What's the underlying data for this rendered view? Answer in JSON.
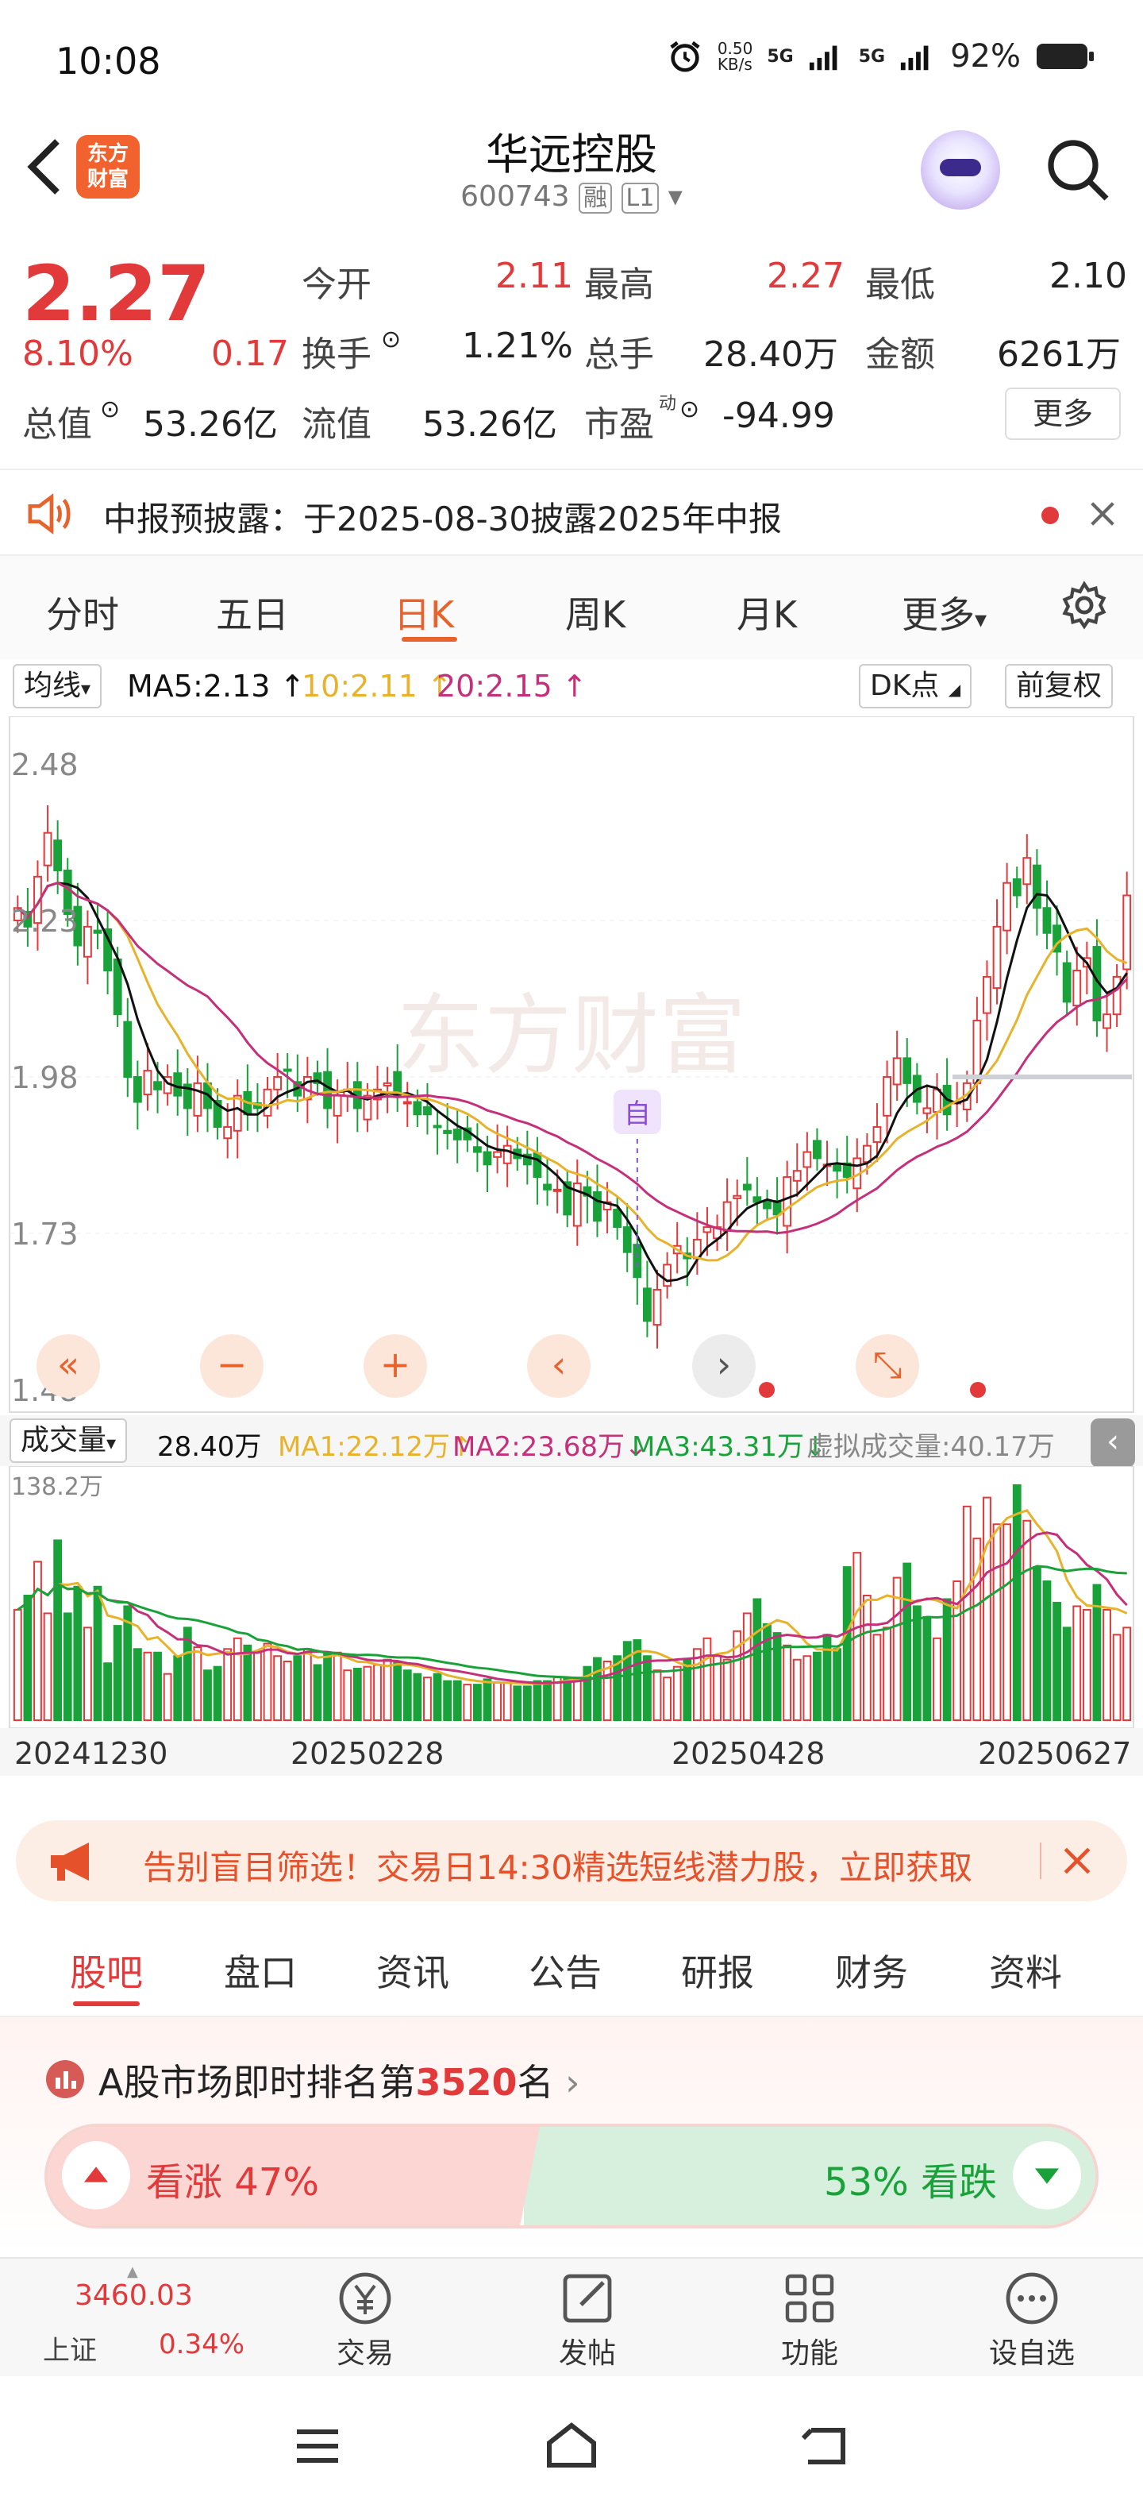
{
  "status_bar": {
    "time": "10:08",
    "net_speed": "0.50\nKB/s",
    "net1": "5G",
    "net2": "5G",
    "battery": "92%"
  },
  "header": {
    "brand": "东方\n财富",
    "title": "华远控股",
    "code": "600743",
    "tag1": "融",
    "tag2": "L1"
  },
  "quote": {
    "price": "2.27",
    "pct": "8.10%",
    "change": "0.17",
    "open_label": "今开",
    "open": "2.11",
    "high_label": "最高",
    "high": "2.27",
    "low_label": "最低",
    "low": "2.10",
    "turnover_label": "换手",
    "turnover": "1.21%",
    "vol_label": "总手",
    "vol": "28.40万",
    "amount_label": "金额",
    "amount": "6261万",
    "mcap_label": "总值",
    "mcap": "53.26亿",
    "float_label": "流值",
    "float": "53.26亿",
    "pe_label": "市盈",
    "pe_sup": "动",
    "pe": "-94.99",
    "more": "更多"
  },
  "notice": {
    "text": "中报预披露：于2025-08-30披露2025年中报"
  },
  "tabs": [
    "分时",
    "五日",
    "日K",
    "周K",
    "月K",
    "更多"
  ],
  "kbar": {
    "mode": "均线",
    "ma5": "MA5:2.13",
    "ma10": "10:2.11",
    "ma20": "20:2.15",
    "dk": "DK点",
    "adj": "前复权"
  },
  "kchart_labels": {
    "y1": "2.48",
    "y2": "2.23",
    "y3": "1.98",
    "y4": "1.73",
    "y5": "1.48",
    "marker": "自",
    "watermark": "东方财富"
  },
  "volbar": {
    "mode": "成交量",
    "vol": "28.40万",
    "ma1": "MA1:22.12万",
    "ma2": "MA2:23.68万",
    "ma3": "MA3:43.31万",
    "virtual": "虚拟成交量:40.17万",
    "ymax": "138.2万"
  },
  "dates": [
    "20241230",
    "20250228",
    "20250428",
    "20250627"
  ],
  "ad": {
    "text": "告别盲目筛选！交易日14:30精选短线潜力股，立即获取"
  },
  "bottom_tabs": [
    "股吧",
    "盘口",
    "资讯",
    "公告",
    "研报",
    "财务",
    "资料"
  ],
  "rank": {
    "prefix": "A股市场即时排名第",
    "rank": "3520",
    "suffix": "名",
    "up": "看涨 47%",
    "down": "53% 看跌"
  },
  "bnav": {
    "index_value": "3460.03",
    "index_name": "上证",
    "index_pct": "0.34%",
    "items": [
      "交易",
      "发帖",
      "功能",
      "设自选"
    ]
  },
  "colors": {
    "up": "#e2393b",
    "down": "#1aa23a",
    "ma5": "#111111",
    "ma10": "#e8b32c",
    "ma20": "#c4307a",
    "accent": "#e8622c"
  },
  "chart_data": [
    {
      "type": "candlestick",
      "title": "",
      "x_range": [
        "20241230",
        "20250630"
      ],
      "ylim": [
        1.48,
        2.48
      ],
      "y_ticks": [
        2.48,
        2.23,
        1.98,
        1.73,
        1.48
      ],
      "close": [
        2.25,
        2.22,
        2.3,
        2.37,
        2.31,
        2.24,
        2.19,
        2.22,
        2.21,
        2.15,
        2.08,
        1.98,
        1.94,
        1.99,
        1.96,
        1.98,
        1.95,
        1.93,
        1.97,
        1.93,
        1.9,
        1.9,
        1.95,
        1.92,
        1.93,
        1.96,
        1.98,
        1.99,
        1.95,
        1.98,
        1.97,
        1.93,
        1.95,
        1.96,
        1.93,
        1.95,
        1.96,
        1.97,
        1.95,
        1.94,
        1.92,
        1.92,
        1.9,
        1.89,
        1.88,
        1.88,
        1.86,
        1.84,
        1.86,
        1.87,
        1.85,
        1.84,
        1.82,
        1.8,
        1.8,
        1.76,
        1.81,
        1.79,
        1.75,
        1.78,
        1.74,
        1.7,
        1.66,
        1.59,
        1.64,
        1.68,
        1.71,
        1.69,
        1.72,
        1.74,
        1.74,
        1.78,
        1.79,
        1.8,
        1.78,
        1.77,
        1.76,
        1.82,
        1.83,
        1.86,
        1.85,
        1.84,
        1.83,
        1.82,
        1.85,
        1.87,
        1.9,
        1.98,
        2.01,
        1.97,
        1.94,
        1.93,
        1.96,
        1.92,
        1.94,
        1.97,
        2.07,
        2.14,
        2.22,
        2.29,
        2.27,
        2.33,
        2.25,
        2.21,
        2.18,
        2.1,
        2.15,
        2.17,
        2.07,
        2.08,
        2.14,
        2.27
      ],
      "ma5_last": 2.13,
      "ma10_last": 2.11,
      "ma20_last": 2.15
    },
    {
      "type": "bar",
      "title": "",
      "ylim": [
        0,
        138.2
      ],
      "unit": "万",
      "values": [
        62,
        70,
        89,
        60,
        101,
        60,
        75,
        52,
        75,
        32,
        53,
        64,
        40,
        38,
        38,
        26,
        36,
        52,
        41,
        28,
        30,
        40,
        46,
        42,
        38,
        43,
        36,
        33,
        36,
        40,
        31,
        38,
        38,
        28,
        29,
        30,
        31,
        34,
        33,
        28,
        26,
        24,
        26,
        22,
        22,
        20,
        20,
        23,
        21,
        21,
        19,
        19,
        22,
        22,
        24,
        24,
        24,
        30,
        35,
        33,
        36,
        44,
        45,
        36,
        28,
        24,
        30,
        34,
        40,
        46,
        36,
        34,
        50,
        60,
        68,
        54,
        49,
        42,
        34,
        36,
        38,
        48,
        40,
        86,
        94,
        70,
        48,
        52,
        80,
        88,
        64,
        58,
        46,
        68,
        78,
        120,
        102,
        125,
        110,
        110,
        132,
        112,
        86,
        78,
        66,
        52,
        64,
        62,
        76,
        62,
        48,
        52
      ]
    }
  ]
}
